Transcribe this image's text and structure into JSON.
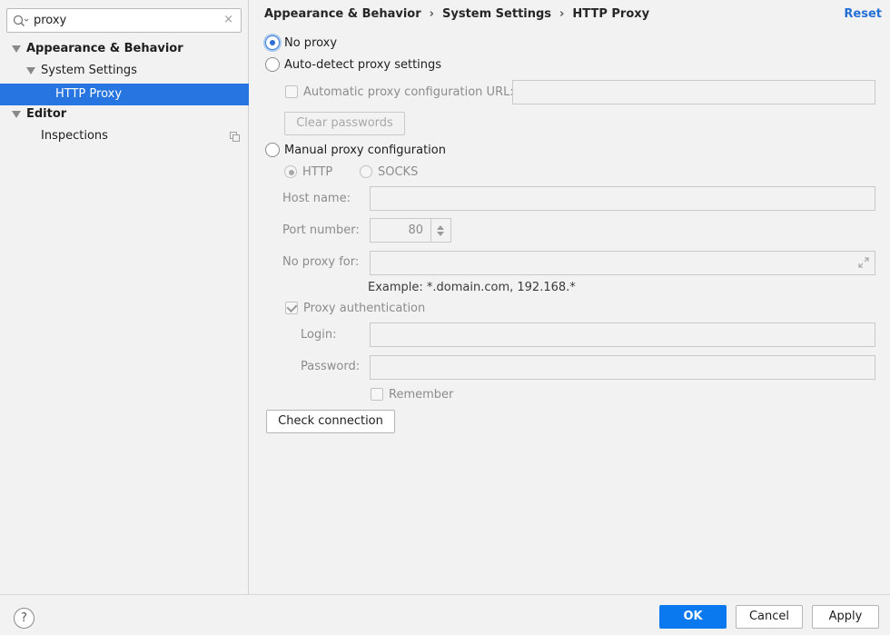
{
  "search": {
    "value": "proxy",
    "clear": "×"
  },
  "tree": [
    {
      "label": "Appearance & Behavior"
    },
    {
      "label": "System Settings"
    },
    {
      "label": "HTTP Proxy"
    },
    {
      "label": "Editor"
    },
    {
      "label": "Inspections"
    }
  ],
  "breadcrumb": {
    "part1": "Appearance & Behavior",
    "sep": "›",
    "part2": "System Settings",
    "part3": "HTTP Proxy"
  },
  "reset_label": "Reset",
  "options": {
    "no_proxy": "No proxy",
    "auto_detect": "Auto-detect proxy settings",
    "auto_config_url": "Automatic proxy configuration URL:",
    "clear_passwords": "Clear passwords",
    "manual": "Manual proxy configuration",
    "http": "HTTP",
    "socks": "SOCKS",
    "host_name": "Host name:",
    "port_number": "Port number:",
    "port_value": "80",
    "no_proxy_for": "No proxy for:",
    "example": "Example: *.domain.com, 192.168.*",
    "proxy_auth": "Proxy authentication",
    "login": "Login:",
    "password": "Password:",
    "remember": "Remember",
    "check_connection": "Check connection"
  },
  "footer": {
    "help": "?",
    "ok": "OK",
    "cancel": "Cancel",
    "apply": "Apply"
  },
  "colors": {
    "accent": "#2675e0",
    "primary_button": "#0a79f0",
    "link": "#2470d6"
  }
}
